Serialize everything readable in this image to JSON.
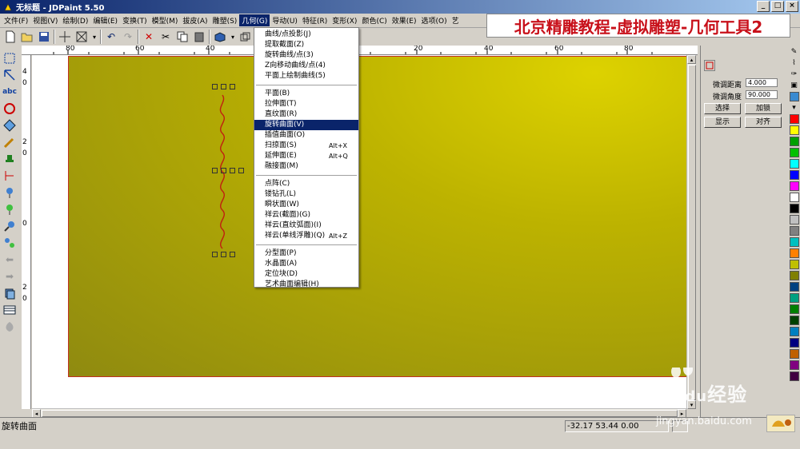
{
  "window": {
    "title": "无标题  - JDPaint 5.50",
    "buttons": [
      "_",
      "□",
      "×"
    ]
  },
  "banner": {
    "text": "北京精雕教程-虚拟雕塑-几何工具2"
  },
  "menubar": {
    "items": [
      {
        "label": "文件(F)"
      },
      {
        "label": "视图(V)"
      },
      {
        "label": "绘制(D)"
      },
      {
        "label": "编辑(E)"
      },
      {
        "label": "变换(T)"
      },
      {
        "label": "模型(M)"
      },
      {
        "label": "拔皮(A)"
      },
      {
        "label": "雕塑(S)"
      },
      {
        "label": "几何(G)",
        "active": true
      },
      {
        "label": "导动(U)"
      },
      {
        "label": "特征(R)"
      },
      {
        "label": "变形(X)"
      },
      {
        "label": "颜色(C)"
      },
      {
        "label": "效果(E)"
      },
      {
        "label": "选项(O)"
      },
      {
        "label": "艺"
      }
    ]
  },
  "geometry_menu": {
    "groups": [
      [
        {
          "label": "曲线/点投影(J)"
        },
        {
          "label": "提取截面(Z)"
        },
        {
          "label": "旋转曲线/点(3)"
        },
        {
          "label": "Z向移动曲线/点(4)"
        },
        {
          "label": "平面上绘制曲线(5)"
        }
      ],
      [
        {
          "label": "平面(B)"
        },
        {
          "label": "拉伸面(T)"
        },
        {
          "label": "直纹面(R)"
        },
        {
          "label": "旋转曲面(V)",
          "highlighted": true
        },
        {
          "label": "插值曲面(O)"
        },
        {
          "label": "扫掠面(S)",
          "shortcut": "Alt+X"
        },
        {
          "label": "延伸面(E)",
          "shortcut": "Alt+Q"
        },
        {
          "label": "融接面(M)"
        }
      ],
      [
        {
          "label": "点阵(C)"
        },
        {
          "label": "镂钻孔(L)"
        },
        {
          "label": "瞬状面(W)"
        },
        {
          "label": "祥云(截面)(G)"
        },
        {
          "label": "祥云(直纹弧面)(I)"
        },
        {
          "label": "祥云(单线浮雕)(Q)",
          "shortcut": "Alt+Z"
        }
      ],
      [
        {
          "label": "分型面(P)"
        },
        {
          "label": "水晶面(A)"
        },
        {
          "label": "定位块(D)"
        },
        {
          "label": "艺术曲面编辑(H)"
        }
      ]
    ]
  },
  "ruler": {
    "top_labels": [
      "80",
      "60",
      "40",
      "20",
      "0",
      "20",
      "40",
      "60",
      "80"
    ],
    "left_labels": [
      "4",
      "0",
      "2",
      "0",
      "0",
      "2",
      "0"
    ]
  },
  "right_panel": {
    "fine_distance_label": "微调距离",
    "fine_distance_value": "4.000",
    "fine_angle_label": "微调角度",
    "fine_angle_value": "90.000",
    "buttons": [
      {
        "label": "选择"
      },
      {
        "label": "加锁"
      },
      {
        "label": "显示"
      },
      {
        "label": "对齐"
      }
    ]
  },
  "palette": {
    "colors": [
      "#ff0000",
      "#ffff00",
      "#00a000",
      "#00c000",
      "#00ffff",
      "#0000ff",
      "#ff00ff",
      "#ffffff",
      "#000000",
      "#c0c0c0",
      "#808080",
      "#00c0c0",
      "#ff8000",
      "#c0c000",
      "#808000",
      "#004080",
      "#00a080",
      "#008000",
      "#004000",
      "#0080c0",
      "#000080",
      "#c06000",
      "#800080",
      "#400040"
    ]
  },
  "statusbar": {
    "message": "旋转曲面",
    "coords": "-32.17 53.44 0.00"
  },
  "watermark": {
    "brand_latin": "Bai",
    "brand_paw": "du",
    "brand_cn": "经验",
    "url": "jingyan.baidu.com"
  }
}
